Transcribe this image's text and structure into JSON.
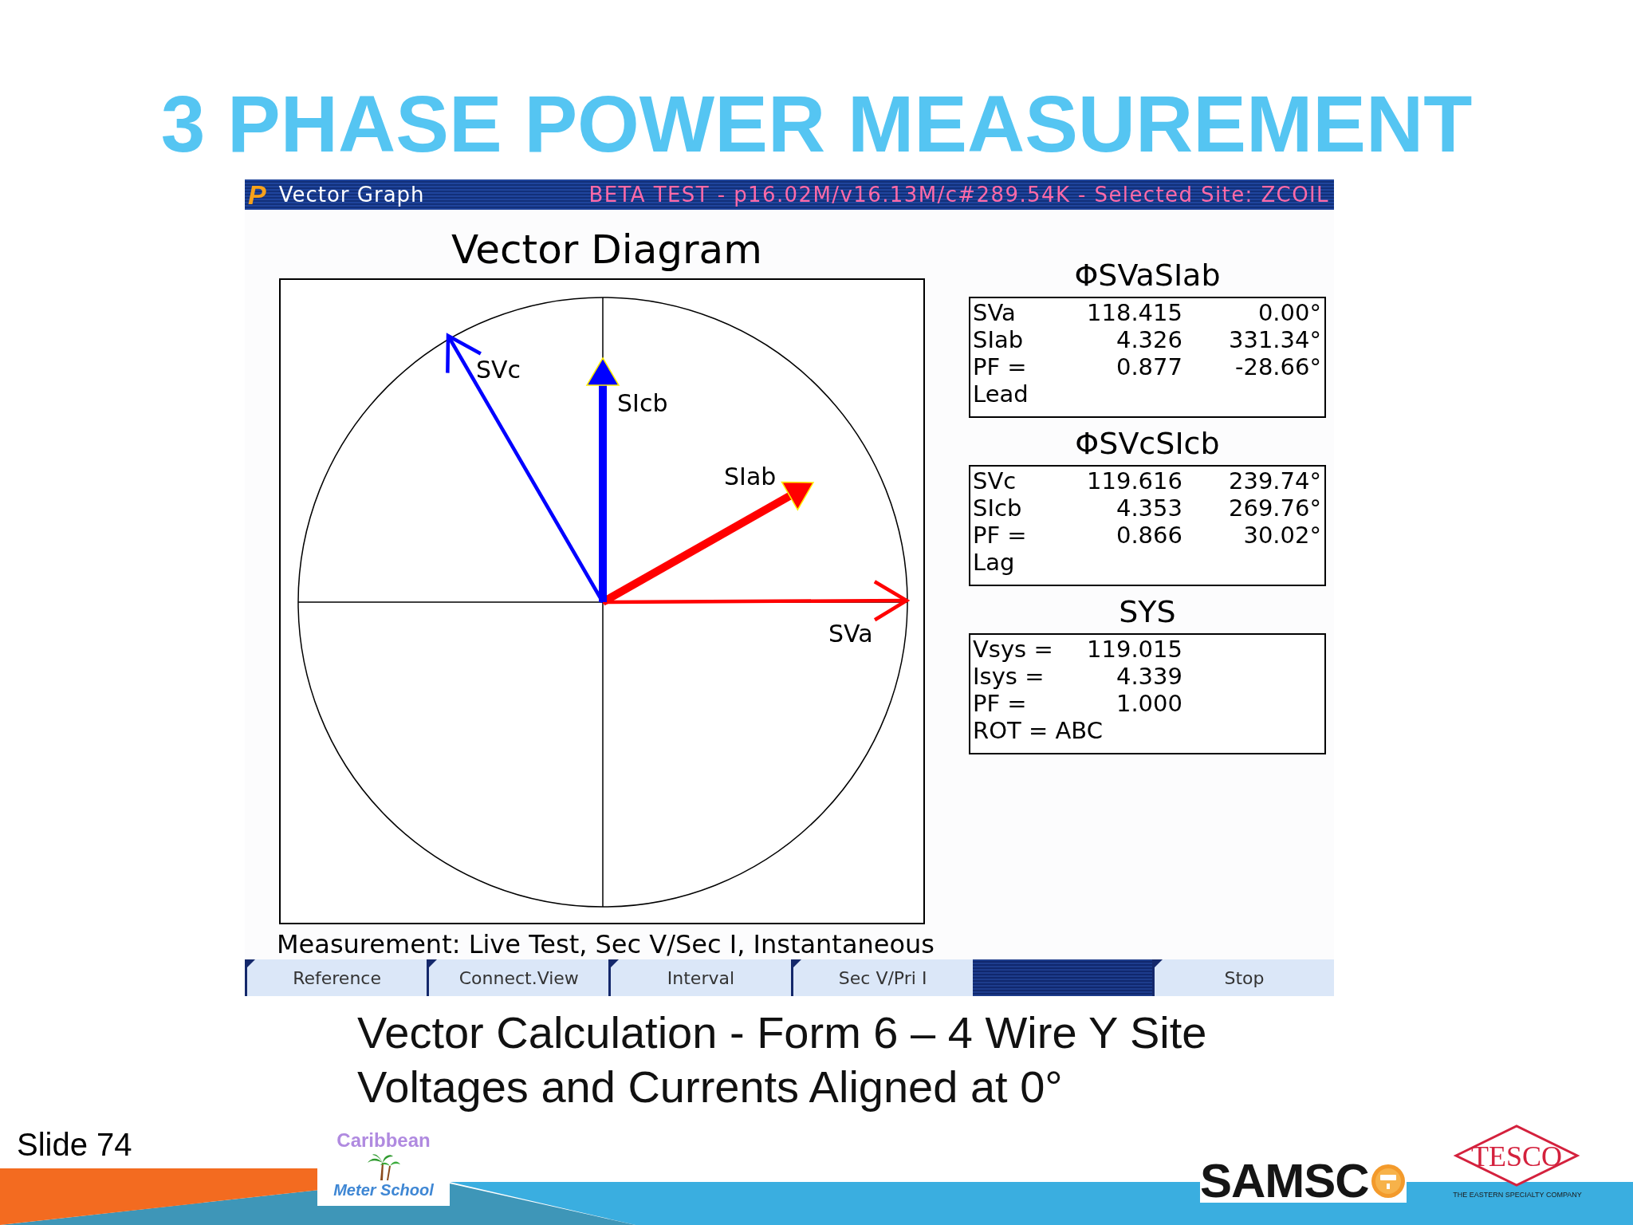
{
  "slide_title": "3 PHASE POWER MEASUREMENT",
  "window": {
    "icon": "P",
    "title": "Vector Graph",
    "status": "BETA TEST - p16.02M/v16.13M/c#289.54K - Selected Site: ZCOIL"
  },
  "diagram": {
    "title": "Vector Diagram",
    "vectors": [
      {
        "label": "SVa",
        "kind": "voltage",
        "color": "#ff0000"
      },
      {
        "label": "SIab",
        "kind": "current",
        "color": "#ff0000"
      },
      {
        "label": "SIcb",
        "kind": "current",
        "color": "#0000ff"
      },
      {
        "label": "SVc",
        "kind": "voltage",
        "color": "#0000ff"
      }
    ],
    "measurement": "Measurement: Live Test, Sec V/Sec I, Instantaneous"
  },
  "readouts": [
    {
      "title": "ΦSVaSIab",
      "rows": [
        [
          "SVa",
          "118.415",
          "0.00°"
        ],
        [
          "SIab",
          "4.326",
          "331.34°"
        ],
        [
          "PF =",
          "0.877",
          "-28.66°"
        ],
        [
          "Lead"
        ]
      ]
    },
    {
      "title": "ΦSVcSIcb",
      "rows": [
        [
          "SVc",
          "119.616",
          "239.74°"
        ],
        [
          "SIcb",
          "4.353",
          "269.76°"
        ],
        [
          "PF =",
          "0.866",
          "30.02°"
        ],
        [
          "Lag"
        ]
      ]
    },
    {
      "title": "SYS",
      "rows": [
        [
          "Vsys =",
          "119.015"
        ],
        [
          "Isys =",
          "4.339"
        ],
        [
          "PF =",
          "1.000"
        ],
        [
          "ROT = ABC"
        ]
      ]
    }
  ],
  "soft_keys": [
    {
      "kind": "key",
      "label": "Reference"
    },
    {
      "kind": "key",
      "label": "Connect.View"
    },
    {
      "kind": "key",
      "label": "Interval"
    },
    {
      "kind": "key",
      "label": "Sec V/Pri I"
    },
    {
      "kind": "blank"
    },
    {
      "kind": "key",
      "label": "Stop"
    }
  ],
  "caption": [
    "Vector Calculation - Form 6 – 4 Wire Y Site",
    "Voltages and Currents Aligned at 0°"
  ],
  "slide_number": "Slide 74",
  "logos": [
    {
      "kind": "school",
      "texts": [
        "Caribbean",
        "Meter School"
      ]
    },
    {
      "kind": "samsco",
      "text": "SAMSC"
    },
    {
      "kind": "tesco",
      "text": "TESCO",
      "tagline": "THE EASTERN SPECIALTY COMPANY"
    }
  ]
}
